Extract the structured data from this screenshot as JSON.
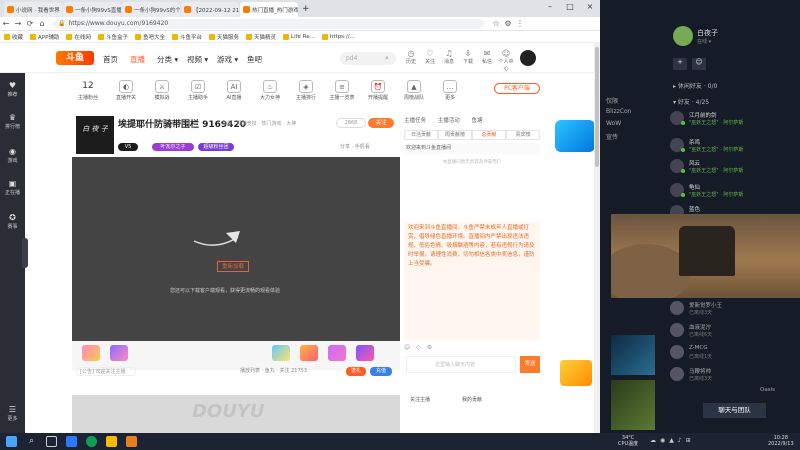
{
  "browser": {
    "tabs": [
      {
        "label": "小说网 · 我看世界 · 名..."
      },
      {
        "label": "一条小狗99vS直播_热门..."
      },
      {
        "label": "一条小狗99vS的个人资料..."
      },
      {
        "label": "【2022-09-12 21点场】..."
      },
      {
        "label": "热门直播_热门游戏直播..."
      }
    ],
    "url": "https://www.douyu.com/9169420",
    "bookmarks": [
      "收藏",
      "APP辅助",
      "在线网",
      "斗鱼盒子",
      "鱼吧大全",
      "斗鱼平台",
      "天猫服务",
      "天猫精灵",
      "Life Re...",
      "https://..."
    ]
  },
  "header": {
    "logo": "斗鱼",
    "nav": [
      "首页",
      "直播",
      "分类 ▾",
      "视频 ▾",
      "游戏 ▾",
      "鱼吧"
    ],
    "search_placeholder": "pd4",
    "icons": [
      "历史",
      "关注",
      "消息",
      "下载",
      "私信",
      "个人中心"
    ]
  },
  "sidebar": [
    "推荐",
    "排行榜",
    "游戏",
    "正在播",
    "赛事",
    "更多"
  ],
  "category": {
    "count": "12",
    "count_label": "主播粉丝",
    "items": [
      "直播开关",
      "模拟战",
      "主播助手",
      "AI直播",
      "大力女神",
      "主播排行",
      "主播一览表",
      "开播提醒",
      "周榜战队",
      "更多"
    ],
    "pc_button": "PC客户端"
  },
  "room": {
    "logo_text": "白 夜 子",
    "title": "埃提耶什防骑带围栏 9169420",
    "meta": "举报 · 网游竞技 · 热门游戏 · 大神",
    "hot": "2868",
    "follow": "关注",
    "badge1": "V5",
    "badge2": "叶瓦尔之子",
    "badge3": "超级粉丝团",
    "actions": "分享 · 手机看",
    "load_button": "重新加载",
    "tip": "您还可以下载客户端观看，获得更流畅的观看体验",
    "input_placeholder": "[公告] 欢迎关注主播",
    "play_nav": "播放列表 · 鱼丸 · 关注 21753",
    "send1": "送礼",
    "send2": "充值",
    "watermark": "DOUYU"
  },
  "right": {
    "tabs": [
      "主播任务",
      "主播活动",
      "鱼塘"
    ],
    "sub": [
      "日活贡献",
      "周贡献榜",
      "总贡献",
      "贵宾榜"
    ],
    "notice": "欢迎来到斗鱼直播间",
    "empty": "本直播间暂无贵宾及神豪用户",
    "chat": "欢迎来到斗鱼直播间。斗鱼严禁未成年人直播或打赏，倡导绿色直播环境。直播间内严禁出现违法违规、低俗色情、吸烟酗酒等内容，若有违规行为请及时举报。请理性消费，切勿相信各类中奖信息，谨防上当受骗。",
    "chat_input": "这里输入聊天内容",
    "chat_send": "发送",
    "bottom_a": "关注主播",
    "bottom_b": "我的贡献"
  },
  "friends": {
    "user": "白夜子",
    "status": "在线 ▾",
    "group1": "▸ 休闲好友 · 0/0",
    "group2": "▾ 好友 · 4/25",
    "list": [
      {
        "name": "江月前的剑",
        "status": "\"巫妖王之怒\" · 阿尔萨斯"
      },
      {
        "name": "杀鸡",
        "status": "\"巫妖王之怒\" · 阿尔萨斯"
      },
      {
        "name": "风云",
        "status": "\"巫妖王之怒\" · 阿尔萨斯"
      },
      {
        "name": "龟仙",
        "status": "\"巫妖王之怒\" · 阿尔萨斯"
      },
      {
        "name": "蓝色",
        "status": "在线"
      }
    ],
    "offline": [
      {
        "name": "爱新觉罗小王",
        "status": "已离线3天"
      },
      {
        "name": "血液泥泞",
        "status": "已离线6天"
      },
      {
        "name": "Z-MCG",
        "status": "已离线1天"
      },
      {
        "name": "马鞭将帅",
        "status": "已离线3天"
      },
      {
        "name": "Oasis",
        "status": "已离线1天"
      }
    ],
    "chat_button": "聊天与团队"
  },
  "strip_labels": [
    "仅限",
    "BlizzCon",
    "WoW",
    "宣传"
  ],
  "taskbar": {
    "tray": "34°C\nCPU温度",
    "time": "10:28",
    "date": "2022/9/13"
  },
  "colors": {
    "accent": "#ff5d23",
    "dark": "#151b27"
  }
}
